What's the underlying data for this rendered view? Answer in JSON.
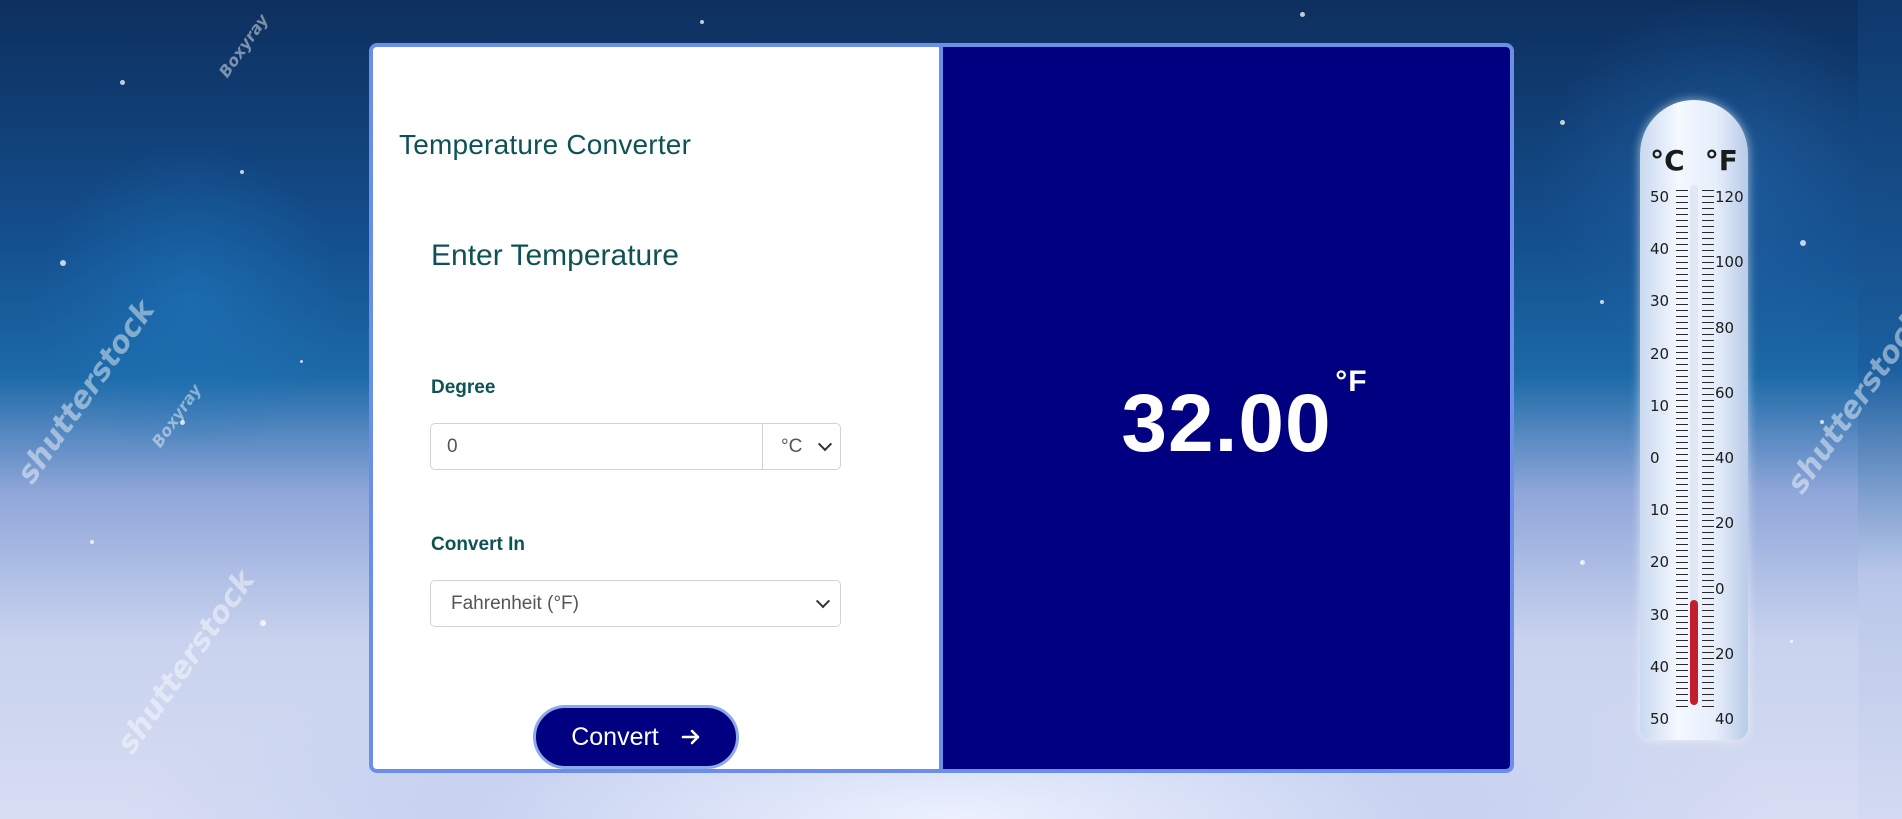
{
  "converter": {
    "app_title": "Temperature Converter",
    "section_title": "Enter Temperature",
    "degree_label": "Degree",
    "degree_value": "0",
    "input_unit": "°C",
    "convert_in_label": "Convert In",
    "convert_in_value": "Fahrenheit (°F)",
    "convert_button": "Convert"
  },
  "result": {
    "value": "32.00",
    "unit": "°F"
  },
  "thermometer": {
    "celsius_label": "°C",
    "fahrenheit_label": "°F",
    "celsius_scale": [
      "50",
      "40",
      "30",
      "20",
      "10",
      "0",
      "10",
      "20",
      "30",
      "40",
      "50"
    ],
    "fahrenheit_scale": [
      "120",
      "100",
      "80",
      "60",
      "40",
      "20",
      "0",
      "20",
      "40"
    ]
  },
  "watermarks": [
    "shutterstock",
    "Boxyray"
  ],
  "colors": {
    "accent": "#000080",
    "border": "#6b8ee8",
    "heading": "#0f5256"
  }
}
